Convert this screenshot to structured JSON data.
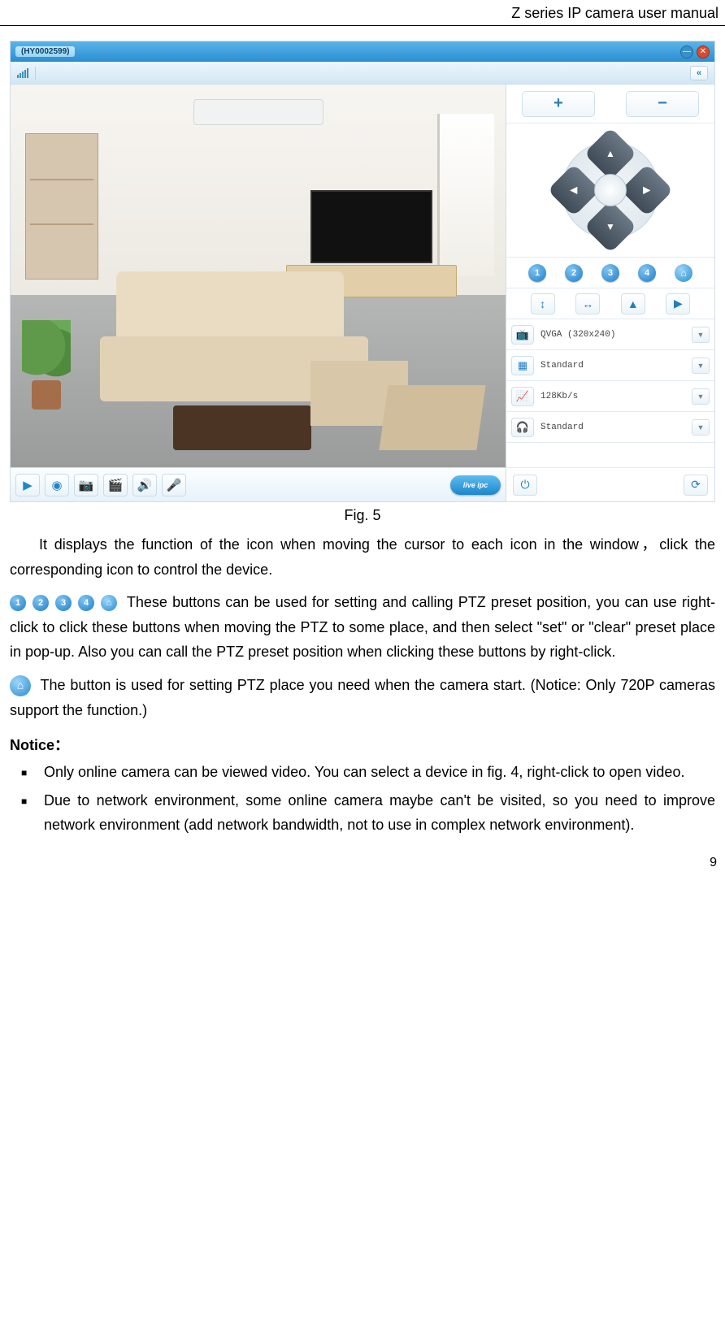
{
  "header": {
    "title": "Z series IP camera user manual"
  },
  "app": {
    "device_label": "(HY0002599)",
    "video_toolbar": {
      "play": "▶",
      "stop": "◉",
      "snapshot": "📷",
      "record": "🎬",
      "audio": "🔊",
      "mic": "🎤",
      "brand": "live ipc"
    },
    "zoom": {
      "plus": "+",
      "minus": "−"
    },
    "ptz": {
      "up": "▲",
      "down": "▼",
      "left": "◀",
      "right": "▶"
    },
    "presets": {
      "p1": "1",
      "p2": "2",
      "p3": "3",
      "p4": "4",
      "home": "⌂"
    },
    "ctrl": {
      "vflip": "↕",
      "hflip": "↔",
      "tri": "▲",
      "flag": "▶"
    },
    "dropdowns": {
      "resolution": {
        "icon": "📺",
        "label": "QVGA (320x240)"
      },
      "quality": {
        "icon": "▦",
        "label": "Standard"
      },
      "bitrate": {
        "icon": "📈",
        "label": "128Kb/s"
      },
      "audio": {
        "icon": "🎧",
        "label": "Standard"
      }
    },
    "side_bottom": {
      "power": "⏻",
      "refresh": "⟳"
    }
  },
  "figure_caption": "Fig. 5",
  "body": {
    "p1": "It displays the function of the icon when moving the cursor to each icon in the window，click the corresponding icon to control the device.",
    "p2": "These buttons can be used for setting and calling PTZ preset position, you can use right-click to click these buttons when moving the PTZ to some place, and then select \"set\" or \"clear\" preset place in pop-up. Also you can call the PTZ preset position when clicking these buttons by right-click.",
    "p3": "The button is used for setting PTZ place you need when the camera start. (Notice: Only 720P cameras support the function.)",
    "notice_heading": "Notice：",
    "notice1": "Only online camera can be viewed video. You can select a device in fig. 4, right-click to open video.",
    "notice2": "Due to network environment, some online camera maybe can't be visited, so you need to improve network environment (add network bandwidth, not to use in complex network environment)."
  },
  "page_number": "9"
}
